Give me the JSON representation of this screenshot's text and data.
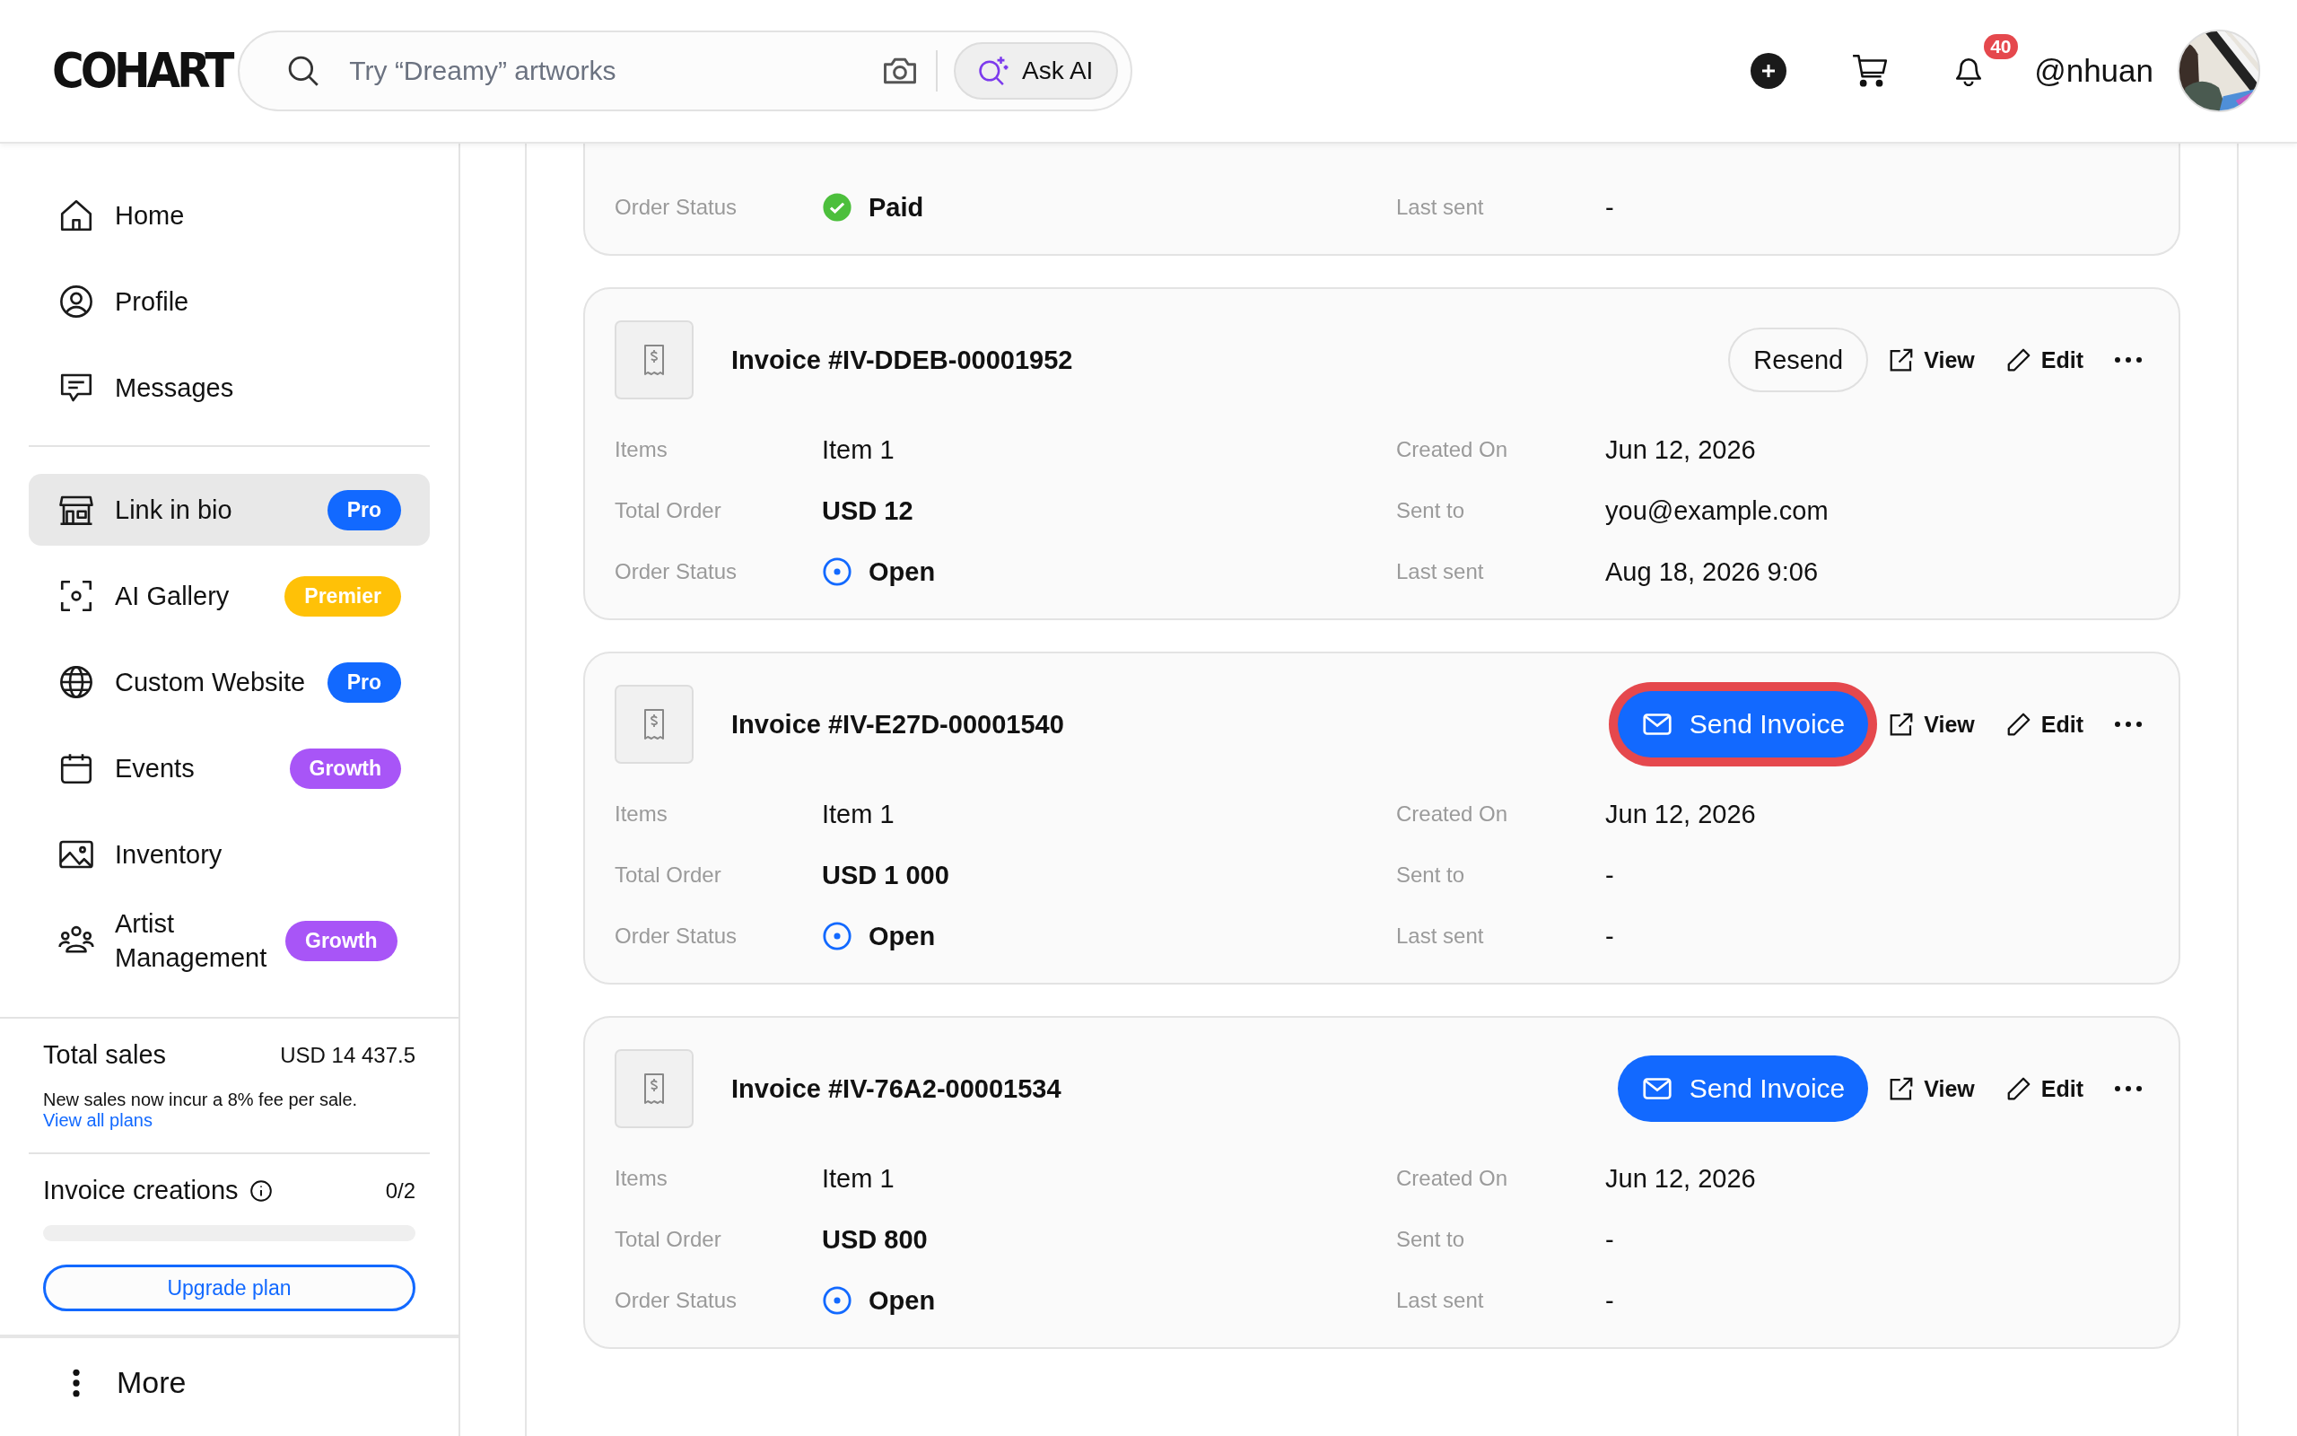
{
  "header": {
    "logo": "COHART",
    "search": {
      "placeholder": "Try “Dreamy” artworks"
    },
    "ask_ai": "Ask AI",
    "notifications": "40",
    "username": "@nhuan"
  },
  "sidebar": {
    "sections": [
      [
        {
          "label": "Home",
          "selected": false
        },
        {
          "label": "Profile",
          "selected": false
        },
        {
          "label": "Messages",
          "selected": false
        }
      ],
      [
        {
          "label": "Link in bio",
          "selected": true,
          "badge": {
            "text": "Pro",
            "color": "#1269ff"
          }
        },
        {
          "label": "AI Gallery",
          "selected": false,
          "badge": {
            "text": "Premier",
            "color": "#ffc107"
          }
        },
        {
          "label": "Custom Website",
          "selected": false,
          "badge": {
            "text": "Pro",
            "color": "#1269ff"
          }
        },
        {
          "label": "Events",
          "selected": false,
          "badge": {
            "text": "Growth",
            "color": "#a855f7"
          }
        },
        {
          "label": "Inventory",
          "selected": false
        },
        {
          "label": "Artist Management",
          "selected": false,
          "badge": {
            "text": "Growth",
            "color": "#a855f7"
          }
        }
      ]
    ],
    "total_sales": {
      "title": "Total sales",
      "amount": "USD 14 437.5",
      "note": "New sales now incur a 8% fee per sale.",
      "link": "View all plans"
    },
    "invoice_creations": {
      "label": "Invoice creations",
      "count": "0/2",
      "level": 0
    },
    "upgrade": "Upgrade plan",
    "more": "More"
  },
  "invoices": [
    {
      "fields": [
        {
          "label": "Order Status",
          "value": "Paid",
          "kind": "status",
          "paid": true
        },
        {
          "label": "Last sent",
          "value": "-",
          "kind": "plain"
        }
      ]
    },
    {
      "title": "Invoice #IV-DDEB-00001952",
      "primary": {
        "label": "Resend",
        "kind": "outline",
        "highlighted": false
      },
      "view": "View",
      "edit": "Edit",
      "fields": [
        {
          "label": "Items",
          "value": "Item 1",
          "kind": "plain"
        },
        {
          "label": "Created On",
          "value": "Jun 12, 2026",
          "kind": "plain"
        },
        {
          "label": "Total Order",
          "value": "USD 12",
          "kind": "bold"
        },
        {
          "label": "Sent to",
          "value": "you@example.com",
          "kind": "plain"
        },
        {
          "label": "Order Status",
          "value": "Open",
          "kind": "status",
          "paid": false
        },
        {
          "label": "Last sent",
          "value": "Aug 18, 2026 9:06",
          "kind": "plain"
        }
      ]
    },
    {
      "title": "Invoice #IV-E27D-00001540",
      "primary": {
        "label": "Send Invoice",
        "kind": "primary",
        "highlighted": true
      },
      "view": "View",
      "edit": "Edit",
      "fields": [
        {
          "label": "Items",
          "value": "Item 1",
          "kind": "plain"
        },
        {
          "label": "Created On",
          "value": "Jun 12, 2026",
          "kind": "plain"
        },
        {
          "label": "Total Order",
          "value": "USD 1 000",
          "kind": "bold"
        },
        {
          "label": "Sent to",
          "value": "-",
          "kind": "plain"
        },
        {
          "label": "Order Status",
          "value": "Open",
          "kind": "status",
          "paid": false
        },
        {
          "label": "Last sent",
          "value": "-",
          "kind": "plain"
        }
      ]
    },
    {
      "title": "Invoice #IV-76A2-00001534",
      "primary": {
        "label": "Send Invoice",
        "kind": "primary",
        "highlighted": false
      },
      "view": "View",
      "edit": "Edit",
      "fields": [
        {
          "label": "Items",
          "value": "Item 1",
          "kind": "plain"
        },
        {
          "label": "Created On",
          "value": "Jun 12, 2026",
          "kind": "plain"
        },
        {
          "label": "Total Order",
          "value": "USD 800",
          "kind": "bold"
        },
        {
          "label": "Sent to",
          "value": "-",
          "kind": "plain"
        },
        {
          "label": "Order Status",
          "value": "Open",
          "kind": "status",
          "paid": false
        },
        {
          "label": "Last sent",
          "value": "-",
          "kind": "plain"
        }
      ]
    }
  ]
}
